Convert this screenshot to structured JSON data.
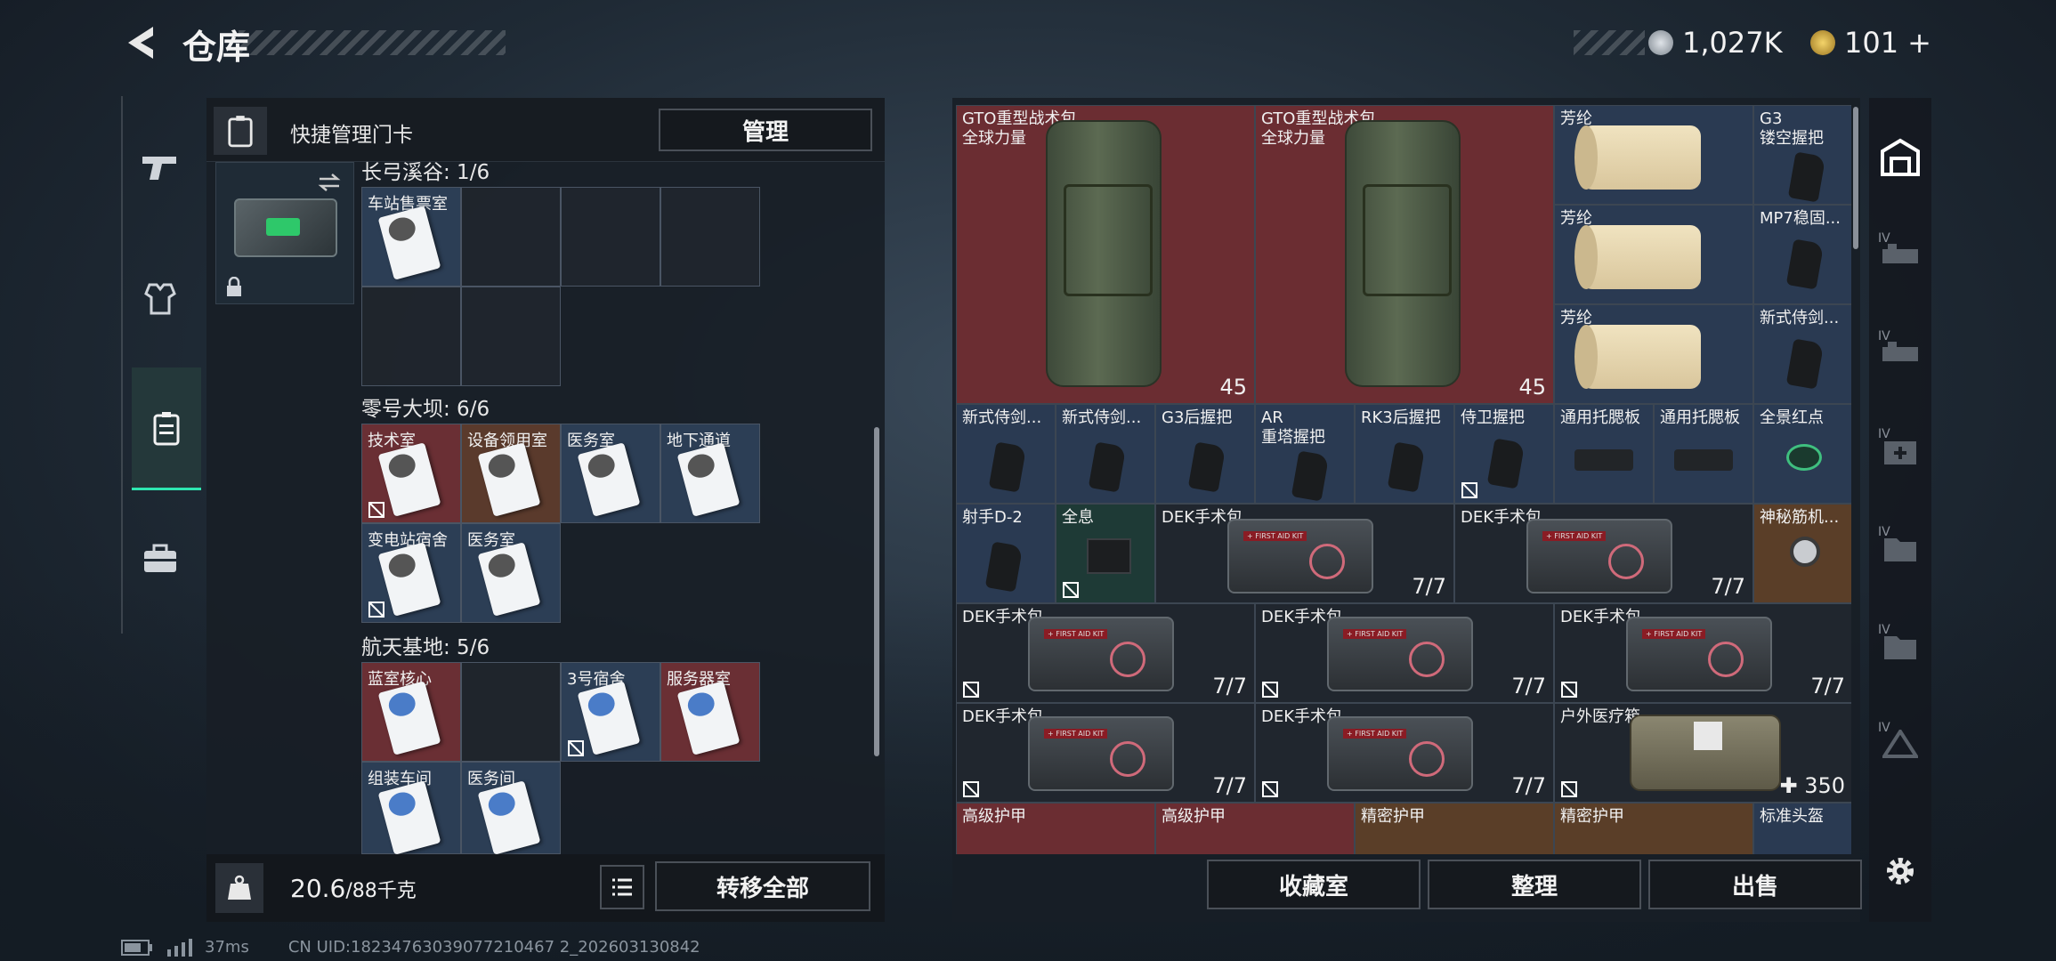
{
  "header": {
    "title": "仓库",
    "currency1": "1,027K",
    "currency2": "101",
    "currency2_plus": "+"
  },
  "left_panel": {
    "header_label": "快捷管理门卡",
    "manage_button": "管理",
    "sections": [
      {
        "title": "长弓溪谷: 1/6",
        "slots": [
          {
            "name": "车站售票室",
            "color": "blue"
          }
        ]
      },
      {
        "title": "零号大坝: 6/6",
        "slots": [
          {
            "name": "技术室",
            "color": "red"
          },
          {
            "name": "设备领用室",
            "color": "brown"
          },
          {
            "name": "医务室",
            "color": "blue"
          },
          {
            "name": "地下通道",
            "color": "blue"
          },
          {
            "name": "变电站宿舍",
            "color": "blue"
          },
          {
            "name": "医务室",
            "color": "blue"
          }
        ]
      },
      {
        "title": "航天基地: 5/6",
        "slots": [
          {
            "name": "蓝室核心",
            "color": "red"
          },
          {
            "name": "3号宿舍",
            "color": "blue"
          },
          {
            "name": "服务器室",
            "color": "red"
          },
          {
            "name": "组装车间",
            "color": "blue"
          },
          {
            "name": "医务间",
            "color": "blue"
          }
        ]
      }
    ],
    "weight": "20.6",
    "weight_cap": "/88千克",
    "transfer_button": "转移全部"
  },
  "grid_items": [
    {
      "name": "GTO重型战术包",
      "sub": "全球力量",
      "count": "45"
    },
    {
      "name": "GTO重型战术包",
      "sub": "全球力量",
      "count": "45"
    },
    {
      "name": "芳纶"
    },
    {
      "name": "G3",
      "sub": "镂空握把"
    },
    {
      "name": "芳纶"
    },
    {
      "name": "MP7稳固..."
    },
    {
      "name": "芳纶"
    },
    {
      "name": "新式侍剑..."
    },
    {
      "name": "新式侍剑..."
    },
    {
      "name": "新式侍剑..."
    },
    {
      "name": "G3后握把"
    },
    {
      "name": "AR",
      "sub": "重塔握把"
    },
    {
      "name": "RK3后握把"
    },
    {
      "name": "侍卫握把"
    },
    {
      "name": "通用托腮板"
    },
    {
      "name": "通用托腮板"
    },
    {
      "name": "全景红点"
    },
    {
      "name": "射手D-2"
    },
    {
      "name": "全息"
    },
    {
      "name": "DEK手术包",
      "count": "7/7"
    },
    {
      "name": "DEK手术包",
      "count": "7/7"
    },
    {
      "name": "神秘筋机..."
    },
    {
      "name": "DEK手术包",
      "count": "7/7"
    },
    {
      "name": "DEK手术包",
      "count": "7/7"
    },
    {
      "name": "DEK手术包",
      "count": "7/7"
    },
    {
      "name": "DEK手术包",
      "count": "7/7"
    },
    {
      "name": "DEK手术包",
      "count": "7/7"
    },
    {
      "name": "户外医疗箱",
      "count": "350"
    },
    {
      "name": "高级护甲"
    },
    {
      "name": "高级护甲"
    },
    {
      "name": "精密护甲"
    },
    {
      "name": "精密护甲"
    },
    {
      "name": "标准头盔"
    }
  ],
  "right_footer": {
    "collection_button": "收藏室",
    "sort_button": "整理",
    "sell_button": "出售"
  },
  "right_sidebar": {
    "tier_labels": [
      "IV",
      "IV",
      "IV",
      "IV",
      "IV",
      "IV"
    ]
  },
  "status": {
    "ping": "37ms",
    "uid": "CN UID:18234763039077210467 2_202603130842"
  }
}
